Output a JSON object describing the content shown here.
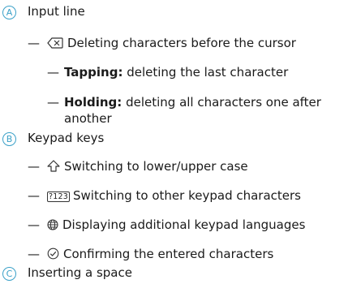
{
  "items": {
    "a": {
      "badge": "A",
      "title": "Input line",
      "delete_text": "Deleting characters before the cursor",
      "tap_label": "Tapping:",
      "tap_text": "deleting the last character",
      "hold_label": "Holding:",
      "hold_text_line1": "deleting all characters one after",
      "hold_text_line2": "another"
    },
    "b": {
      "badge": "B",
      "title": "Keypad keys",
      "shift_text": "Switching to lower/upper case",
      "numkey_label": "?123",
      "numkey_text": "Switching to other keypad characters",
      "globe_text": "Displaying additional keypad languages",
      "confirm_text": "Confirming the entered characters"
    },
    "c": {
      "badge": "C",
      "title": "Inserting a space"
    }
  },
  "dash_char": "—",
  "accent_color": "#3aa0c8",
  "icons": [
    "backspace-icon",
    "shift-arrow-icon",
    "numeric-key-icon",
    "globe-icon",
    "confirm-check-icon"
  ]
}
